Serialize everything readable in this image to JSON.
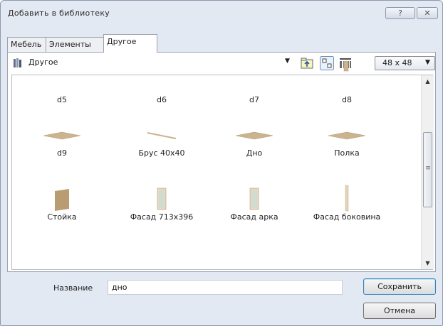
{
  "window": {
    "title": "Добавить в библиотеку",
    "help_label": "?",
    "close_label": "✕"
  },
  "tabs": [
    {
      "label": "Мебель"
    },
    {
      "label": "Элементы"
    },
    {
      "label": "Другое",
      "active": true
    }
  ],
  "toolbar": {
    "category": "Другое",
    "icon_size": "48 x 48"
  },
  "items": [
    {
      "label": "d5",
      "thumb": "none"
    },
    {
      "label": "d6",
      "thumb": "none"
    },
    {
      "label": "d7",
      "thumb": "none"
    },
    {
      "label": "d8",
      "thumb": "vertical-panel"
    },
    {
      "label": "d9",
      "thumb": "flat-board"
    },
    {
      "label": "Брус 40x40",
      "thumb": "beam"
    },
    {
      "label": "Дно",
      "thumb": "flat-board"
    },
    {
      "label": "Полка",
      "thumb": "flat-board"
    },
    {
      "label": "Стойка",
      "thumb": "stand"
    },
    {
      "label": "Фасад 713x396",
      "thumb": "facade"
    },
    {
      "label": "Фасад арка",
      "thumb": "facade"
    },
    {
      "label": "Фасад боковина",
      "thumb": "side-panel"
    }
  ],
  "form": {
    "name_label": "Название",
    "name_value": "дно"
  },
  "buttons": {
    "save": "Сохранить",
    "cancel": "Отмена"
  },
  "colors": {
    "wood": "#cbb38f",
    "wood_dark": "#b99c72",
    "window_bg": "#e3e9f2",
    "accent_border": "#3c7fb1"
  }
}
